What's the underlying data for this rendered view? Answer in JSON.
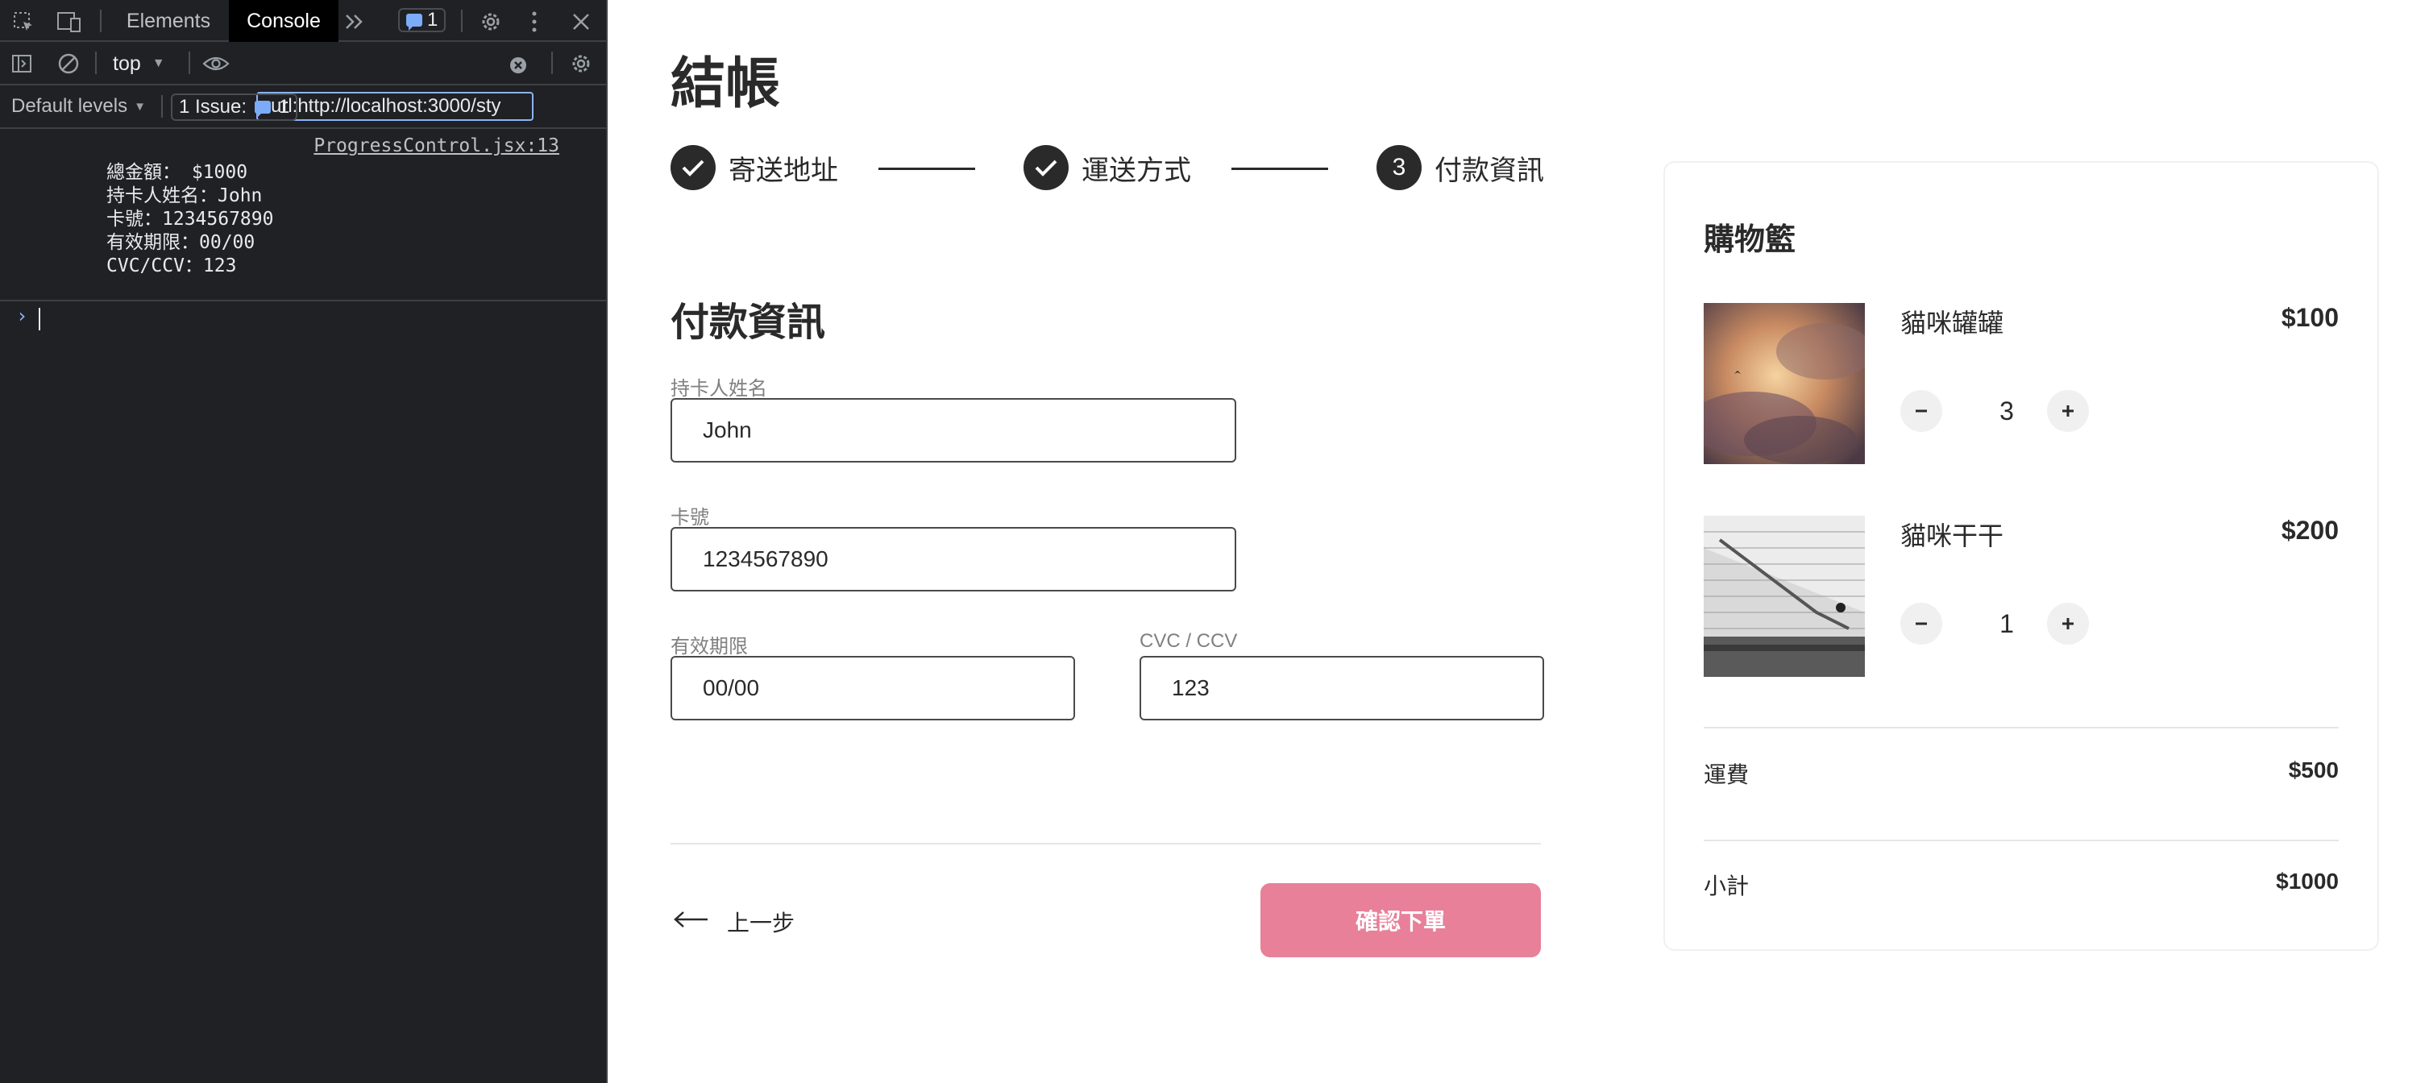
{
  "devtools": {
    "tabs": {
      "elements": "Elements",
      "console": "Console"
    },
    "issues_badge_count": "1",
    "context": "top",
    "filter_value": "-url:http://localhost:3000/sty",
    "default_levels": "Default levels",
    "issues_button": {
      "label": "1 Issue:",
      "count": "1"
    },
    "console": {
      "source": "ProgressControl.jsx:13",
      "lines": [
        "總金額： $1000",
        "持卡人姓名：John",
        "卡號：1234567890",
        "有效期限：00/00",
        "CVC/CCV：123"
      ],
      "prompt": "›"
    },
    "icons": [
      "inspect-icon",
      "device-toolbar-icon",
      "more-tabs-icon",
      "settings-icon",
      "kebab-menu-icon",
      "close-icon",
      "sidebar-icon",
      "clear-console-icon",
      "eye-icon",
      "clear-filter-icon",
      "console-settings-icon"
    ]
  },
  "page": {
    "title": "結帳",
    "steps": [
      {
        "label": "寄送地址",
        "state": "done"
      },
      {
        "label": "運送方式",
        "state": "done"
      },
      {
        "number": "3",
        "label": "付款資訊",
        "state": "active"
      }
    ],
    "section_title": "付款資訊",
    "form": {
      "cardholder": {
        "label": "持卡人姓名",
        "value": "John"
      },
      "card_number": {
        "label": "卡號",
        "value": "1234567890"
      },
      "expiry": {
        "label": "有效期限",
        "value": "00/00"
      },
      "cvc": {
        "label": "CVC / CCV",
        "value": "123"
      }
    },
    "back_label": "上一步",
    "confirm_label": "確認下單",
    "accent_color": "#e8809a"
  },
  "cart": {
    "title": "購物籃",
    "items": [
      {
        "name": "貓咪罐罐",
        "price": "$100",
        "qty": "3"
      },
      {
        "name": "貓咪干干",
        "price": "$200",
        "qty": "1"
      }
    ],
    "shipping": {
      "label": "運費",
      "value": "$500"
    },
    "subtotal": {
      "label": "小計",
      "value": "$1000"
    }
  }
}
